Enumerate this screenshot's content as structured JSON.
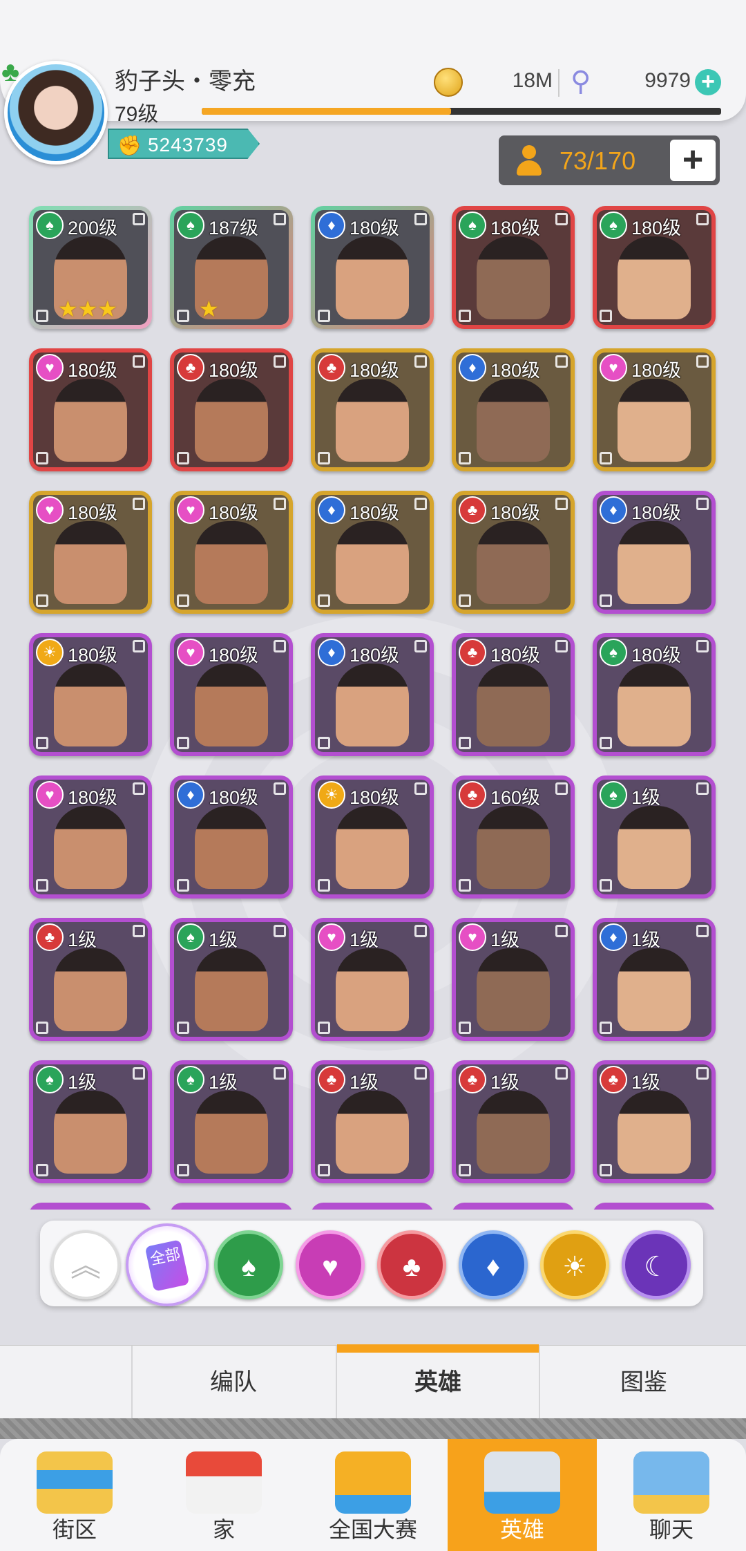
{
  "header": {
    "player_name": "豹子头・零充",
    "player_level": "79级",
    "gold": "18M",
    "gems": "9979",
    "power": "5243739",
    "hero_count": "73/170",
    "xp_progress": 0.48
  },
  "heroes": [
    {
      "level": "200级",
      "element": "green",
      "rarity": "pink",
      "bg": "multi",
      "stars": "★★★"
    },
    {
      "level": "187级",
      "element": "green",
      "rarity": "green",
      "bg": "multi",
      "stars": "★"
    },
    {
      "level": "180级",
      "element": "blue",
      "rarity": "green",
      "bg": "multi",
      "stars": ""
    },
    {
      "level": "180级",
      "element": "green",
      "rarity": "red",
      "bg": "red",
      "stars": ""
    },
    {
      "level": "180级",
      "element": "green",
      "rarity": "red",
      "bg": "red",
      "stars": ""
    },
    {
      "level": "180级",
      "element": "pink",
      "rarity": "red",
      "bg": "red",
      "stars": ""
    },
    {
      "level": "180级",
      "element": "red",
      "rarity": "red",
      "bg": "red",
      "stars": ""
    },
    {
      "level": "180级",
      "element": "red",
      "rarity": "gold",
      "bg": "gold",
      "stars": ""
    },
    {
      "level": "180级",
      "element": "blue",
      "rarity": "gold",
      "bg": "gold",
      "stars": ""
    },
    {
      "level": "180级",
      "element": "pink",
      "rarity": "gold",
      "bg": "gold",
      "stars": ""
    },
    {
      "level": "180级",
      "element": "pink",
      "rarity": "gold",
      "bg": "gold",
      "stars": ""
    },
    {
      "level": "180级",
      "element": "pink",
      "rarity": "gold",
      "bg": "gold",
      "stars": ""
    },
    {
      "level": "180级",
      "element": "blue",
      "rarity": "gold",
      "bg": "gold",
      "stars": ""
    },
    {
      "level": "180级",
      "element": "red",
      "rarity": "gold",
      "bg": "gold",
      "stars": ""
    },
    {
      "level": "180级",
      "element": "blue",
      "rarity": "purple",
      "bg": "purple",
      "stars": ""
    },
    {
      "level": "180级",
      "element": "gold",
      "rarity": "purple",
      "bg": "purple",
      "stars": ""
    },
    {
      "level": "180级",
      "element": "pink",
      "rarity": "purple",
      "bg": "purple",
      "stars": ""
    },
    {
      "level": "180级",
      "element": "blue",
      "rarity": "purple",
      "bg": "purple",
      "stars": ""
    },
    {
      "level": "180级",
      "element": "red",
      "rarity": "purple",
      "bg": "purple",
      "stars": ""
    },
    {
      "level": "180级",
      "element": "green",
      "rarity": "purple",
      "bg": "purple",
      "stars": ""
    },
    {
      "level": "180级",
      "element": "pink",
      "rarity": "purple",
      "bg": "purple",
      "stars": ""
    },
    {
      "level": "180级",
      "element": "blue",
      "rarity": "purple",
      "bg": "purple",
      "stars": ""
    },
    {
      "level": "180级",
      "element": "gold",
      "rarity": "purple",
      "bg": "purple",
      "stars": ""
    },
    {
      "level": "160级",
      "element": "red",
      "rarity": "purple",
      "bg": "purple",
      "stars": ""
    },
    {
      "level": "1级",
      "element": "green",
      "rarity": "purple",
      "bg": "purple",
      "stars": ""
    },
    {
      "level": "1级",
      "element": "red",
      "rarity": "purple",
      "bg": "purple",
      "stars": ""
    },
    {
      "level": "1级",
      "element": "green",
      "rarity": "purple",
      "bg": "purple",
      "stars": ""
    },
    {
      "level": "1级",
      "element": "pink",
      "rarity": "purple",
      "bg": "purple",
      "stars": ""
    },
    {
      "level": "1级",
      "element": "pink",
      "rarity": "purple",
      "bg": "purple",
      "stars": ""
    },
    {
      "level": "1级",
      "element": "blue",
      "rarity": "purple",
      "bg": "purple",
      "stars": ""
    },
    {
      "level": "1级",
      "element": "green",
      "rarity": "purple",
      "bg": "purple",
      "stars": ""
    },
    {
      "level": "1级",
      "element": "green",
      "rarity": "purple",
      "bg": "purple",
      "stars": ""
    },
    {
      "level": "1级",
      "element": "red",
      "rarity": "purple",
      "bg": "purple",
      "stars": ""
    },
    {
      "level": "1级",
      "element": "red",
      "rarity": "purple",
      "bg": "purple",
      "stars": ""
    },
    {
      "level": "1级",
      "element": "red",
      "rarity": "purple",
      "bg": "purple",
      "stars": ""
    }
  ],
  "filter": {
    "all_label": "全部",
    "buttons": [
      "scroll-top",
      "all",
      "spade",
      "heart",
      "club",
      "diamond",
      "sun",
      "moon"
    ]
  },
  "tabs": {
    "formation": "编队",
    "heroes": "英雄",
    "codex": "图鉴"
  },
  "nav": {
    "street": "街区",
    "home": "家",
    "tournament": "全国大赛",
    "heroes": "英雄",
    "chat": "聊天"
  },
  "colors": {
    "accent": "#f7a21b",
    "teal": "#3cc7b5",
    "element_green": "#2aa45a",
    "element_blue": "#2f6ed7",
    "element_red": "#d73a3a",
    "element_pink": "#e64fc4",
    "element_gold": "#f0a916"
  }
}
